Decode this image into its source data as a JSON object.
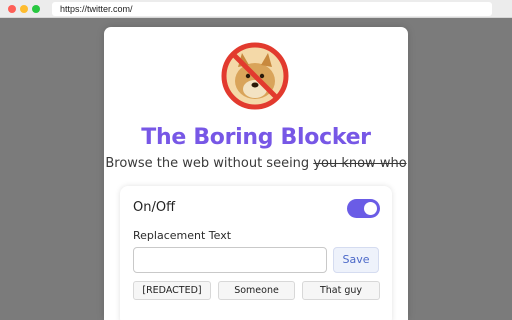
{
  "browser": {
    "url": "https://twitter.com/"
  },
  "popup": {
    "title": "The Boring Blocker",
    "subtitle_prefix": "Browse the web without seeing ",
    "subtitle_struck": "you know who",
    "onoff_label": "On/Off",
    "toggle_on": true,
    "replacement_label": "Replacement Text",
    "replacement_value": "",
    "save_label": "Save",
    "presets": [
      "[REDACTED]",
      "Someone",
      "That guy"
    ]
  },
  "colors": {
    "title": "#7757e6",
    "toggle": "#6a5ce6",
    "ban_circle": "#e23a2e"
  }
}
